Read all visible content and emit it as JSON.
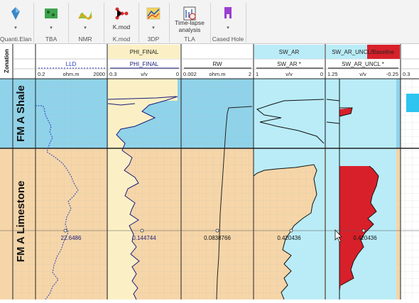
{
  "ribbon": {
    "buttons": [
      {
        "label": "",
        "group": "Quanti.Elan",
        "icon": "quanti-elan-icon"
      },
      {
        "label": "",
        "group": "TBA",
        "icon": "tba-icon"
      },
      {
        "label": "",
        "group": "NMR",
        "icon": "nmr-icon"
      },
      {
        "label": "K.mod",
        "group": "K.mod",
        "icon": "kmod-icon"
      },
      {
        "label": "",
        "group": "3DP",
        "icon": "3dp-icon"
      },
      {
        "label": "Time-lapse analysis",
        "group": "TLA",
        "icon": "time-lapse-icon"
      },
      {
        "label": "",
        "group": "Cased Hole",
        "icon": "cased-hole-icon"
      }
    ]
  },
  "tracks": {
    "zonation": {
      "title": "Zonation"
    },
    "lld": {
      "name": "LLD",
      "min": "0.2",
      "unit": "ohm.m",
      "max": "2000",
      "readout": "22.6486"
    },
    "phi": {
      "header": "PHI_FINAL",
      "name": "PHI_FINAL",
      "min": "0.3",
      "unit": "v/v",
      "max": "0",
      "readout": "0.144744"
    },
    "rw": {
      "name": "RW",
      "min": "0.002",
      "unit": "ohm.m",
      "max": "2",
      "readout": "0.0838766"
    },
    "swar": {
      "header": "SW_AR",
      "name": "SW_AR *",
      "min": "1",
      "unit": "v/v",
      "max": "0",
      "readout": "0.420436"
    },
    "swuncl": {
      "header": "SW_AR_UNCL/Baseline",
      "name": "SW_AR_UNCL *",
      "min": "1.25",
      "unit": "v/v",
      "max": "-0.25",
      "readout": "0.420436"
    },
    "partial": {
      "min": "0.3"
    }
  },
  "zones": [
    {
      "name": "FM A Shale",
      "color": "#8fd3ea"
    },
    {
      "name": "FM A Limestone",
      "color": "#f6d6a8"
    }
  ],
  "colors": {
    "phi_fill": "#fbf0c5",
    "sw_fill": "#b9ecf7",
    "uncl_fill": "#d8202a",
    "ribbon_bg": "#f3f3f3"
  }
}
